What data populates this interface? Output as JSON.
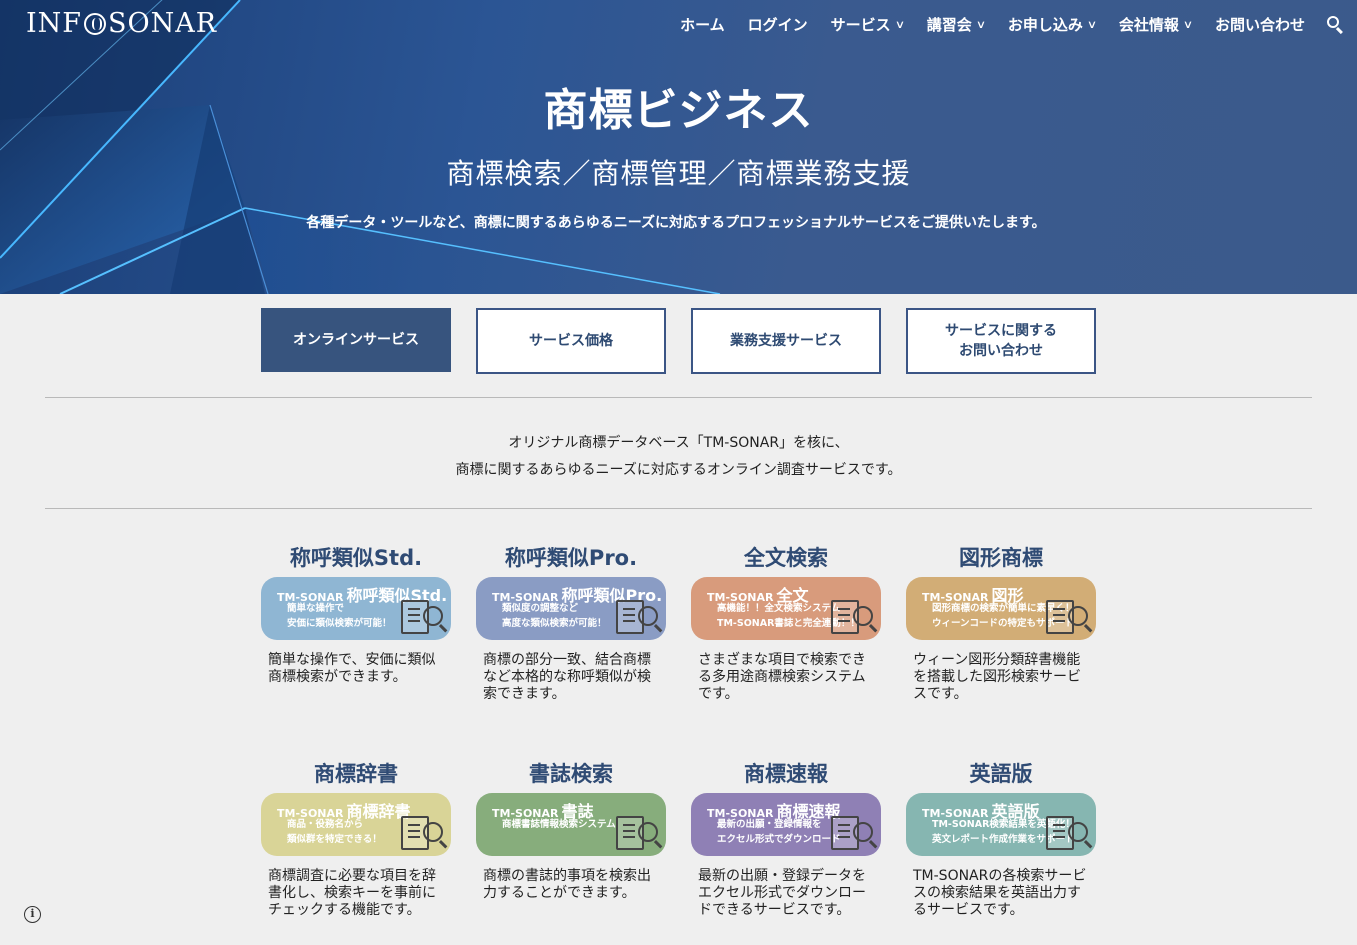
{
  "header": {
    "logo_text_left": "INF",
    "logo_text_right": "SONAR",
    "nav": [
      {
        "label": "ホーム",
        "dropdown": false
      },
      {
        "label": "ログイン",
        "dropdown": false
      },
      {
        "label": "サービス",
        "dropdown": true
      },
      {
        "label": "講習会",
        "dropdown": true
      },
      {
        "label": "お申し込み",
        "dropdown": true
      },
      {
        "label": "会社情報",
        "dropdown": true
      },
      {
        "label": "お問い合わせ",
        "dropdown": false
      }
    ]
  },
  "hero": {
    "title": "商標ビジネス",
    "subtitle": "商標検索／商標管理／商標業務支援",
    "lead": "各種データ・ツールなど、商標に関するあらゆるニーズに対応するプロフェッショナルサービスをご提供いたします。"
  },
  "tabs": [
    {
      "label": "オンラインサービス",
      "active": true
    },
    {
      "label": "サービス価格",
      "active": false
    },
    {
      "label": "業務支援サービス",
      "active": false
    },
    {
      "label": "サービスに関する\nお問い合わせ",
      "active": false
    }
  ],
  "intro": {
    "line1": "オリジナル商標データベース「TM-SONAR」を核に、",
    "line2": "商標に関するあらゆるニーズに対応するオンライン調査サービスです。"
  },
  "services": [
    {
      "title": "称呼類似Std.",
      "brand": "TM-SONAR",
      "brand_name": "称呼類似Std.",
      "sub1": "簡単な操作で",
      "sub2": "安価に類似検索が可能！",
      "color": "#8fb6d3",
      "desc": "簡単な操作で、安価に類似商標検索ができます。"
    },
    {
      "title": "称呼類似Pro.",
      "brand": "TM-SONAR",
      "brand_name": "称呼類似Pro.",
      "sub1": "類似度の調整など",
      "sub2": "高度な類似検索が可能！",
      "color": "#8a9cc4",
      "desc": "商標の部分一致、結合商標など本格的な称呼類似が検索できます。"
    },
    {
      "title": "全文検索",
      "brand": "TM-SONAR",
      "brand_name": "全文",
      "sub1": "高機能！！全文検索システム",
      "sub2": "TM-SONAR書誌と完全連動！！",
      "color": "#d89b7c",
      "desc": "さまざまな項目で検索できる多用途商標検索システムです。"
    },
    {
      "title": "図形商標",
      "brand": "TM-SONAR",
      "brand_name": "図形",
      "sub1": "図形商標の検索が簡単に素早く！",
      "sub2": "ウィーンコードの特定もサポート",
      "color": "#d2ad76",
      "desc": "ウィーン図形分類辞書機能を搭載した図形検索サービスです。"
    },
    {
      "title": "商標辞書",
      "brand": "TM-SONAR",
      "brand_name": "商標辞書",
      "sub1": "商品・役務名から",
      "sub2": "類似群を特定できる！",
      "color": "#d9d497",
      "desc": "商標調査に必要な項目を辞書化し、検索キーを事前にチェックする機能です。"
    },
    {
      "title": "書誌検索",
      "brand": "TM-SONAR",
      "brand_name": "書誌",
      "sub1": "商標書誌情報検索システム",
      "sub2": "",
      "color": "#87ad7c",
      "desc": "商標の書誌的事項を検索出力することができます。"
    },
    {
      "title": "商標速報",
      "brand": "TM-SONAR",
      "brand_name": "商標速報",
      "sub1": "最新の出願・登録情報を",
      "sub2": "エクセル形式でダウンロード",
      "color": "#8f80b5",
      "desc": "最新の出願・登録データをエクセル形式でダウンロードできるサービスです。"
    },
    {
      "title": "英語版",
      "brand": "TM-SONAR",
      "brand_name": "英語版",
      "sub1": "TM-SONAR検索結果を英語化！",
      "sub2": "英文レポート作成作業をサポート",
      "color": "#86b6b1",
      "desc": "TM-SONARの各検索サービスの検索結果を英語出力するサービスです。"
    }
  ],
  "icons": {
    "search": "search-icon",
    "chevron": "chevron-down-icon",
    "info": "info-icon"
  }
}
